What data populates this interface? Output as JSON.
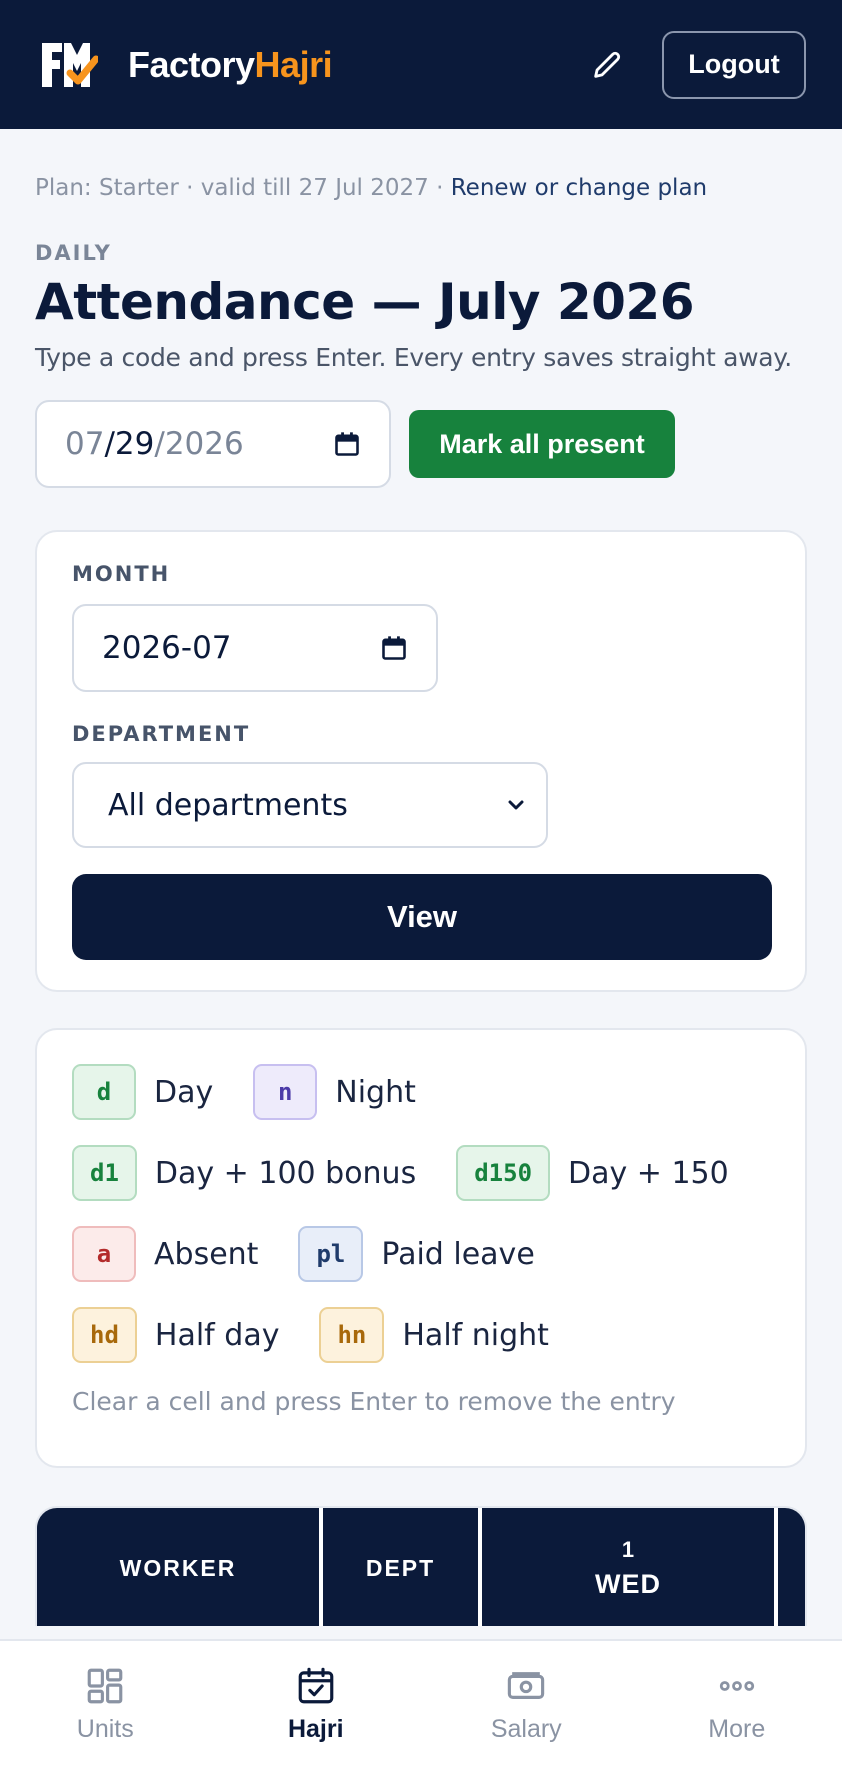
{
  "header": {
    "brand_part1": "Factory",
    "brand_part2": "Hajri",
    "logout_label": "Logout",
    "edit_icon": "pencil-icon",
    "colors": {
      "background": "#0b1a3a",
      "brand_accent": "#f7941d"
    }
  },
  "plan": {
    "text": "Plan: Starter · valid till 27 Jul 2027 · ",
    "link": "Renew or change plan"
  },
  "page": {
    "eyebrow": "DAILY",
    "title": "Attendance — July 2026",
    "subtitle": "Type a code and press Enter. Every entry saves straight away."
  },
  "date_picker": {
    "month": "07",
    "sep1": "/",
    "day": "29",
    "sep2": "/",
    "year": "2026",
    "icon": "calendar-icon"
  },
  "mark_all_label": "Mark all present",
  "filters": {
    "month_label": "MONTH",
    "month_value": "2026-07",
    "department_label": "DEPARTMENT",
    "department_value": "All departments",
    "view_label": "View"
  },
  "legend": {
    "rows": [
      [
        {
          "code": "d",
          "label": "Day",
          "color": "green"
        },
        {
          "code": "n",
          "label": "Night",
          "color": "purple"
        }
      ],
      [
        {
          "code": "d1",
          "label": "Day + 100 bonus",
          "color": "green"
        },
        {
          "code": "d150",
          "label": "Day + 150",
          "color": "green"
        }
      ],
      [
        {
          "code": "a",
          "label": "Absent",
          "color": "red"
        },
        {
          "code": "pl",
          "label": "Paid leave",
          "color": "blue"
        }
      ],
      [
        {
          "code": "hd",
          "label": "Half day",
          "color": "amber"
        },
        {
          "code": "hn",
          "label": "Half night",
          "color": "amber"
        }
      ]
    ],
    "hint": "Clear a cell and press Enter to remove the entry"
  },
  "table": {
    "headers": {
      "worker": "WORKER",
      "dept": "DEPT",
      "day_num": "1",
      "day_name": "WED"
    }
  },
  "nav": {
    "items": [
      {
        "label": "Units",
        "icon": "grid-icon",
        "active": false
      },
      {
        "label": "Hajri",
        "icon": "calendar-check-icon",
        "active": true
      },
      {
        "label": "Salary",
        "icon": "cash-icon",
        "active": false
      },
      {
        "label": "More",
        "icon": "dots-icon",
        "active": false
      }
    ]
  }
}
